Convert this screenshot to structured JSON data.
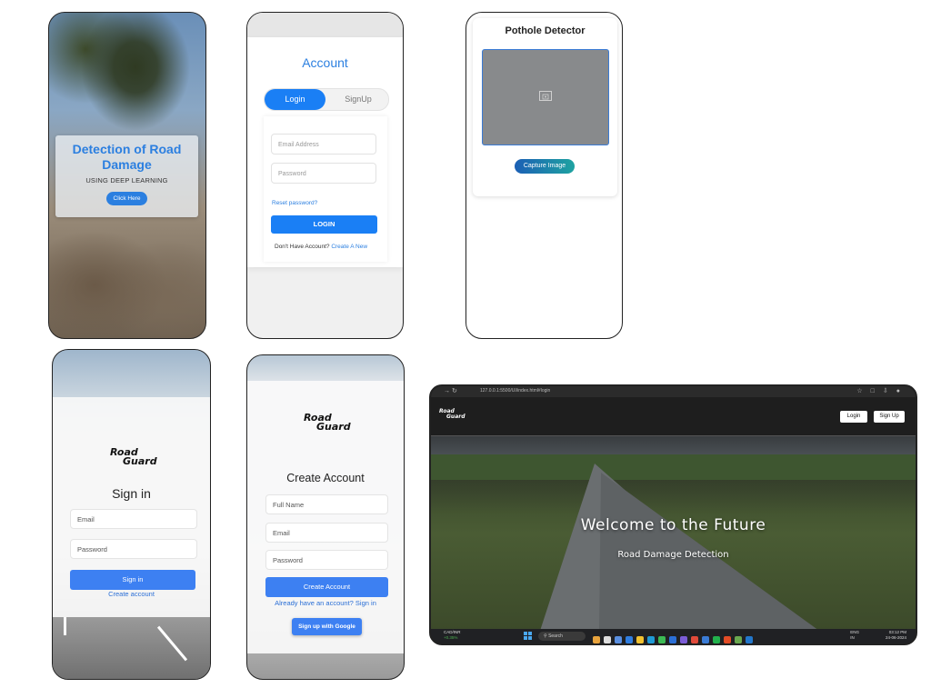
{
  "screen1": {
    "title": "Detection of Road Damage",
    "subtitle": "USING DEEP LEARNING",
    "button": "Click Here"
  },
  "screen2": {
    "title": "Account",
    "tab_login": "Login",
    "tab_signup": "SignUp",
    "email_placeholder": "Email Address",
    "password_placeholder": "Password",
    "reset_link": "Reset password?",
    "login_button": "LOGIN",
    "no_account_text": "Don't Have Account?",
    "create_link": "Create A New"
  },
  "screen3": {
    "title": "Pothole Detector",
    "capture_button": "Capture Image",
    "placeholder_icon": "image-icon"
  },
  "screen4": {
    "logo_line1": "Road",
    "logo_line2": "Guard",
    "title": "Sign in",
    "email_placeholder": "Email",
    "password_placeholder": "Password",
    "signin_button": "Sign in",
    "create_link": "Create account"
  },
  "screen5": {
    "logo_line1": "Road",
    "logo_line2": "Guard",
    "title": "Create Account",
    "fullname_placeholder": "Full Name",
    "email_placeholder": "Email",
    "password_placeholder": "Password",
    "create_button": "Create Account",
    "signin_link": "Already have an account? Sign in",
    "google_button": "Sign up with Google"
  },
  "browser": {
    "url": "127.0.0.1:5500/UI/index.html#login",
    "brand_line1": "Road",
    "brand_line2": "Guard",
    "login_button": "Login",
    "signup_button": "Sign Up",
    "heading": "Welcome to the Future",
    "subheading": "Road Damage Detection",
    "taskbar": {
      "weather_label": "CAD/INR",
      "weather_change": "+0.35%",
      "search_label": "Search",
      "lang_line1": "ENG",
      "lang_line2": "IN",
      "time": "03:12 PM",
      "date": "24-06-2024"
    },
    "colors": {
      "accent_blue": "#3d80f2"
    }
  }
}
